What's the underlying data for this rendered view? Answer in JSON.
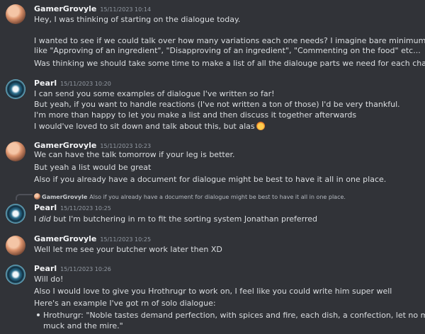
{
  "messages": [
    {
      "author": "GamerGrovyle",
      "timestamp": "15/11/2023 10:14",
      "lines": [
        "Hey, I was thinking of starting on the dialogue today.",
        "I wanted to see if we could talk over how many variations each one needs? I imagine bare minimum is a few lines for things",
        "like \"Approving of an ingredient\", \"Disapproving of an ingredient\", \"Commenting on the food\" etc...",
        "Was thinking we should take some time to make a list of all the dialouge parts we need for each characters"
      ]
    },
    {
      "author": "Pearl",
      "timestamp": "15/11/2023 10:20",
      "lines": [
        "I can send you some examples of dialogue I've written so far!",
        "But yeah, if you want to handle reactions (I've not written a ton of those) I'd be very thankful.",
        "I'm more than happy to let you make a list and then discuss it together afterwards",
        "I would've loved to sit down and talk about this, but alas"
      ],
      "emoji": "distressed-emoji"
    },
    {
      "author": "GamerGrovyle",
      "timestamp": "15/11/2023 10:23",
      "lines": [
        "We can have the talk tomorrow if your leg is better.",
        "But yeah a list would be great",
        "Also if you already have a document for dialogue might be best to have it all in one place."
      ]
    },
    {
      "author": "Pearl",
      "timestamp": "15/11/2023 10:25",
      "reply_to": {
        "author": "GamerGrovyle",
        "text": "Also if you already have a document for dialogue might be best to have it all in one place."
      },
      "lines_parts": {
        "before": "I ",
        "italic": "did",
        "after": " but I'm butchering in rn to fit the sorting system Jonathan preferred"
      }
    },
    {
      "author": "GamerGrovyle",
      "timestamp": "15/11/2023 10:25",
      "lines": [
        "Well let me see your butcher work later then XD"
      ]
    },
    {
      "author": "Pearl",
      "timestamp": "15/11/2023 10:26",
      "lines": [
        "Will do!",
        "Also I would love to give you Hrothrugr to work on, I feel like you could write him super well",
        "Here's an example I've got rn of solo dialogue:"
      ],
      "bullet_lines": [
        "Hrothurgr: \"Noble tastes demand perfection, with spices and fire, each dish, a confection, let no morsel languish in the",
        "muck and the mire.\""
      ]
    }
  ]
}
